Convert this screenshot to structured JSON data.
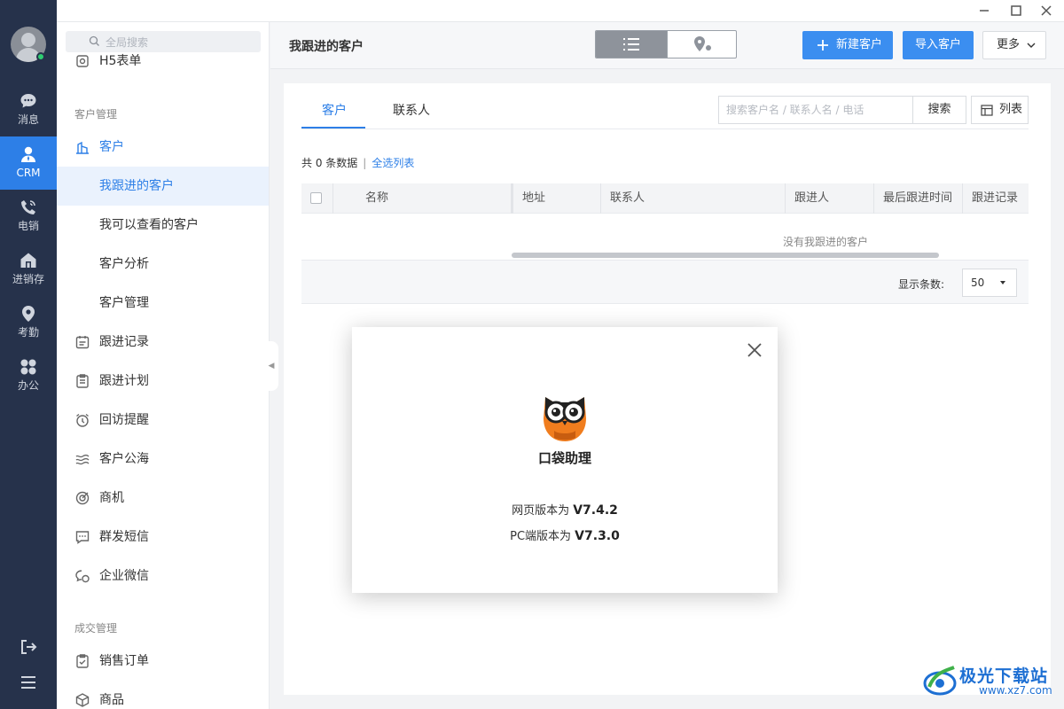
{
  "rail": {
    "items": [
      {
        "label": "消息",
        "icon": "chat-icon"
      },
      {
        "label": "CRM",
        "icon": "person-icon"
      },
      {
        "label": "电销",
        "icon": "phone-icon"
      },
      {
        "label": "进销存",
        "icon": "house-icon"
      },
      {
        "label": "考勤",
        "icon": "location-pin-icon"
      },
      {
        "label": "办公",
        "icon": "grid-icon"
      }
    ],
    "active": "CRM"
  },
  "sidebar": {
    "search_placeholder": "全局搜索",
    "partial_item": "H5表单",
    "section_customer": "客户管理",
    "customer_parent": "客户",
    "sub_items": [
      "我跟进的客户",
      "我可以查看的客户",
      "客户分析",
      "客户管理"
    ],
    "items": [
      "跟进记录",
      "跟进计划",
      "回访提醒",
      "客户公海",
      "商机",
      "群发短信",
      "企业微信"
    ],
    "section_deal": "成交管理",
    "deal_items": [
      "销售订单",
      "商品"
    ]
  },
  "header": {
    "title": "我跟进的客户",
    "new_customer": "新建客户",
    "import_customer": "导入客户",
    "more": "更多"
  },
  "tabs": [
    "客户",
    "联系人"
  ],
  "search": {
    "placeholder": "搜索客户名 / 联系人名 / 电话",
    "button": "搜索"
  },
  "list_button": "列表",
  "summary": {
    "count_text": "共 0 条数据",
    "select_all": "全选列表"
  },
  "table": {
    "columns": [
      "名称",
      "地址",
      "联系人",
      "跟进人",
      "最后跟进时间",
      "跟进记录"
    ],
    "empty_text": "没有我跟进的客户",
    "page_size_label": "显示条数:",
    "page_size": "50"
  },
  "modal": {
    "app_name": "口袋助理",
    "web_version_label": "网页版本为 ",
    "web_version": "V7.4.2",
    "pc_version_label": "PC端版本为 ",
    "pc_version": "V7.3.0"
  },
  "watermark": {
    "title": "极光下载站",
    "url": "www.xz7.com"
  },
  "colors": {
    "accent": "#2d7fe7",
    "rail_bg": "#26324b",
    "button_blue": "#3b8ef0",
    "owl_orange": "#f07d1e"
  }
}
